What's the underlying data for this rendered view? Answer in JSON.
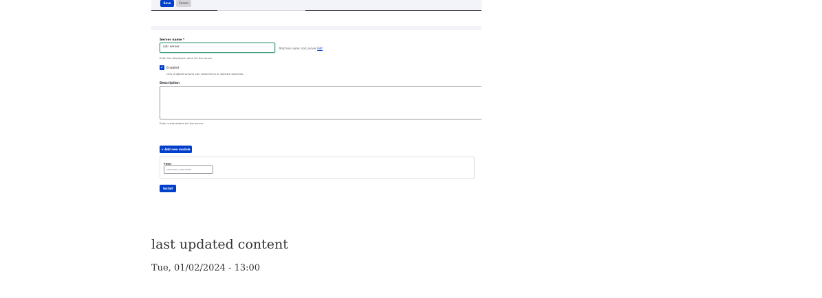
{
  "toolbar": {
    "save_label": "Save",
    "cancel_label": "Cancel"
  },
  "form": {
    "server_name_label": "Server name *",
    "server_name_value": "solr server",
    "machine_name_prefix": "Machine name: solr_server",
    "machine_name_edit": "Edit",
    "server_name_hint": "Enter the displayed name for the server.",
    "enabled_label": "Enabled",
    "enabled_hint": "Only enabled servers can index items or execute searches.",
    "description_label": "Description",
    "description_hint": "Enter a description for the server.",
    "add_module_label": "+ Add new module",
    "filter_label": "Filter",
    "filter_value": "common_overrides",
    "install_label": "Install"
  },
  "content": {
    "heading": "last updated content",
    "date": "Tue, 01/02/2024 - 13:00"
  },
  "colors": {
    "primary": "#003ecc",
    "focus": "#3f9c75"
  }
}
